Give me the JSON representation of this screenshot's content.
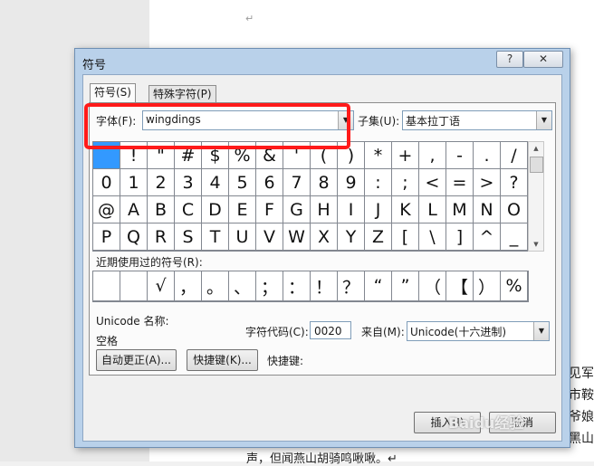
{
  "document": {
    "paragraph_mark": "↵",
    "side_text": [
      "见军",
      "市鞍",
      "爷娘",
      "黑山"
    ],
    "bottom_text": "声，但闻燕山胡骑鸣啾啾。↵"
  },
  "dialog": {
    "title": "符号",
    "help_label": "?",
    "close_label": "✕",
    "tabs": [
      {
        "label": "符号(S)"
      },
      {
        "label": "特殊字符(P)"
      }
    ],
    "font_label": "字体(F):",
    "font_value": "wingdings",
    "subset_label": "子集(U):",
    "subset_value": "基本拉丁语",
    "symbol_rows": [
      [
        "",
        "!",
        "\"",
        "#",
        "$",
        "%",
        "&",
        "'",
        "(",
        ")",
        "*",
        "+",
        ",",
        "-",
        ".",
        "/"
      ],
      [
        "0",
        "1",
        "2",
        "3",
        "4",
        "5",
        "6",
        "7",
        "8",
        "9",
        ":",
        ";",
        "<",
        "=",
        ">",
        "?"
      ],
      [
        "@",
        "A",
        "B",
        "C",
        "D",
        "E",
        "F",
        "G",
        "H",
        "I",
        "J",
        "K",
        "L",
        "M",
        "N",
        "O"
      ],
      [
        "P",
        "Q",
        "R",
        "S",
        "T",
        "U",
        "V",
        "W",
        "X",
        "Y",
        "Z",
        "[",
        "\\",
        "]",
        "^",
        "_"
      ]
    ],
    "recent_label": "近期使用过的符号(R):",
    "recent_symbols": [
      "",
      "",
      "√",
      "，",
      "。",
      "、",
      "；",
      "：",
      "！",
      "？",
      "“",
      "”",
      "（",
      "【",
      "）",
      "%"
    ],
    "unicode_name_label": "Unicode 名称:",
    "unicode_name_value": "空格",
    "char_code_label": "字符代码(C):",
    "char_code_value": "0020",
    "from_label": "来自(M):",
    "from_value": "Unicode(十六进制)",
    "autocorrect_button": "自动更正(A)...",
    "shortcut_key_button": "快捷键(K)...",
    "shortcut_key_label": "快捷键:",
    "insert_button": "插入(I)",
    "cancel_button": "取消"
  },
  "watermark_text": "Baidu经验",
  "colors": {
    "highlight": "#ff1a1a",
    "selected_cell": "#3399ff",
    "dialog_frame": "#b9d1ea"
  }
}
